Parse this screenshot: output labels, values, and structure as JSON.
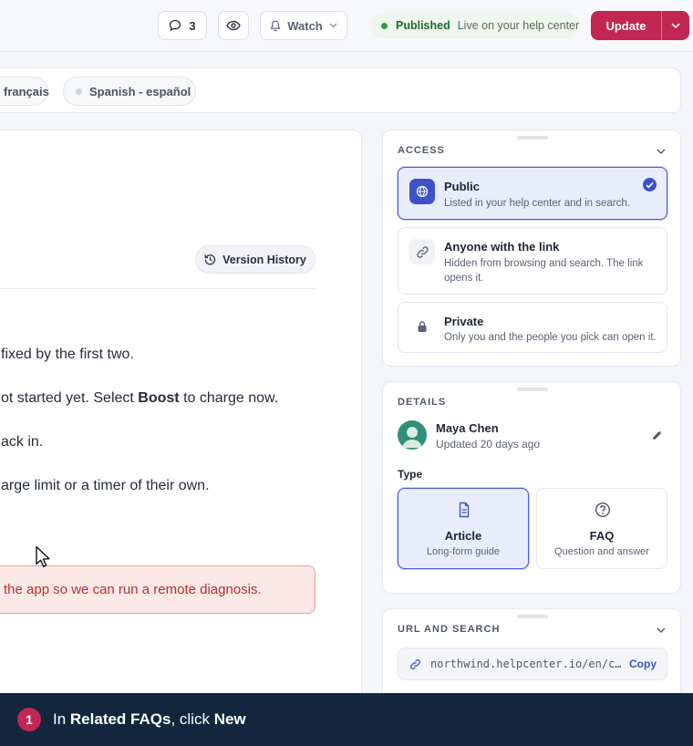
{
  "topbar": {
    "comment_count": "3",
    "watch_label": "Watch",
    "status_label": "Published",
    "status_sub": "Live on your help center",
    "update_label": "Update"
  },
  "languages": [
    {
      "label": "français"
    },
    {
      "label": "Spanish - español"
    }
  ],
  "editor": {
    "version_history_label": "Version History",
    "lines": [
      "fixed by the first two.",
      "ot started yet. Select ",
      "ack in.",
      "arge limit or a timer of their own."
    ],
    "boost_word": "Boost",
    "line2_tail": " to charge now.",
    "callout_text": "the app so we can run a remote diagnosis."
  },
  "access": {
    "title": "ACCESS",
    "options": [
      {
        "title": "Public",
        "desc": "Listed in your help center and in search.",
        "selected": true,
        "icon": "globe-icon"
      },
      {
        "title": "Anyone with the link",
        "desc": "Hidden from browsing and search. The link opens it.",
        "selected": false,
        "icon": "link-icon"
      },
      {
        "title": "Private",
        "desc": "Only you and the people you pick can open it.",
        "selected": false,
        "icon": "lock-icon"
      }
    ]
  },
  "details": {
    "title": "DETAILS",
    "author_name": "Maya Chen",
    "author_meta": "Updated 20 days ago",
    "type_label": "Type",
    "types": [
      {
        "title": "Article",
        "desc": "Long-form guide",
        "selected": true,
        "icon": "document-icon"
      },
      {
        "title": "FAQ",
        "desc": "Question and answer",
        "selected": false,
        "icon": "question-icon"
      }
    ]
  },
  "url_search": {
    "title": "URL AND SEARCH",
    "url": "northwind.helpcenter.io/en/c…",
    "copy_label": "Copy"
  },
  "banner": {
    "step": "1",
    "prefix": "In ",
    "target": "Related FAQs",
    "middle": ", click ",
    "action": "New"
  },
  "colors": {
    "accent": "#c22753",
    "primary": "#3f51c8",
    "banner_bg": "#12263d",
    "published_green": "#2e9a4a"
  }
}
